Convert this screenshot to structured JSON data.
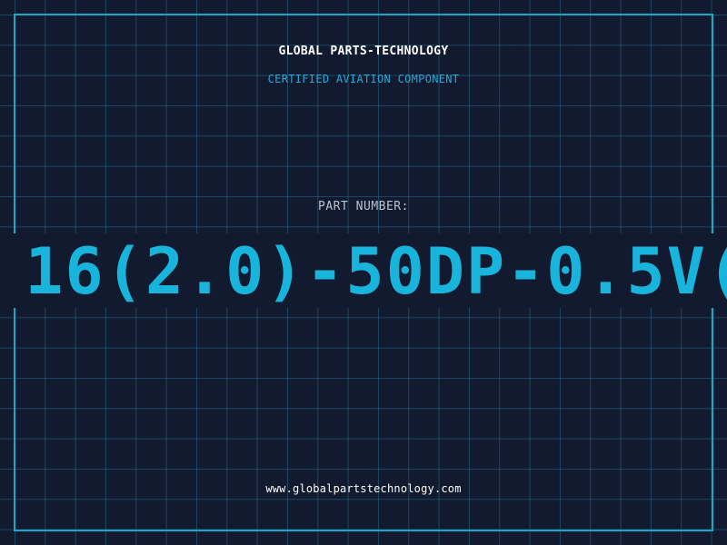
{
  "brand": {
    "title": "GLOBAL PARTS-TECHNOLOGY",
    "subtitle": "CERTIFIED AVIATION COMPONENT"
  },
  "part": {
    "label": "PART NUMBER:",
    "number_visible": "16(2.0)-50DP-0.5V("
  },
  "footer": {
    "website": "www.globalpartstechnology.com"
  },
  "colors": {
    "background": "#111a2e",
    "grid": "#226e8c",
    "frame": "#1aa9c8",
    "accent": "#19b4dc",
    "title": "#ffffff",
    "label": "#b9c4d2"
  }
}
